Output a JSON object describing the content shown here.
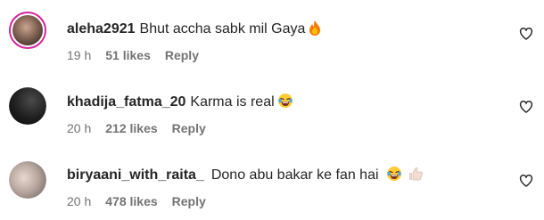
{
  "comments": [
    {
      "username": "aleha2921",
      "text": "Bhut accha sabk mil Gaya",
      "emojis": [
        "fire-emoji"
      ],
      "time": "19 h",
      "likes": "51 likes",
      "reply": "Reply",
      "has_story_ring": true
    },
    {
      "username": "khadija_fatma_20",
      "text": "Karma is real",
      "emojis": [
        "laughing-emoji"
      ],
      "time": "20 h",
      "likes": "212 likes",
      "reply": "Reply",
      "has_story_ring": false
    },
    {
      "username": "biryaani_with_raita_",
      "text": "Dono abu bakar ke fan hai",
      "emojis": [
        "laughing-emoji",
        "thumbs-up-emoji"
      ],
      "time": "20 h",
      "likes": "478 likes",
      "reply": "Reply",
      "has_story_ring": false
    }
  ],
  "icons": {
    "like": "heart-outline-icon"
  },
  "colors": {
    "text": "#262626",
    "meta": "#737373",
    "story_ring": "#d6249f"
  }
}
